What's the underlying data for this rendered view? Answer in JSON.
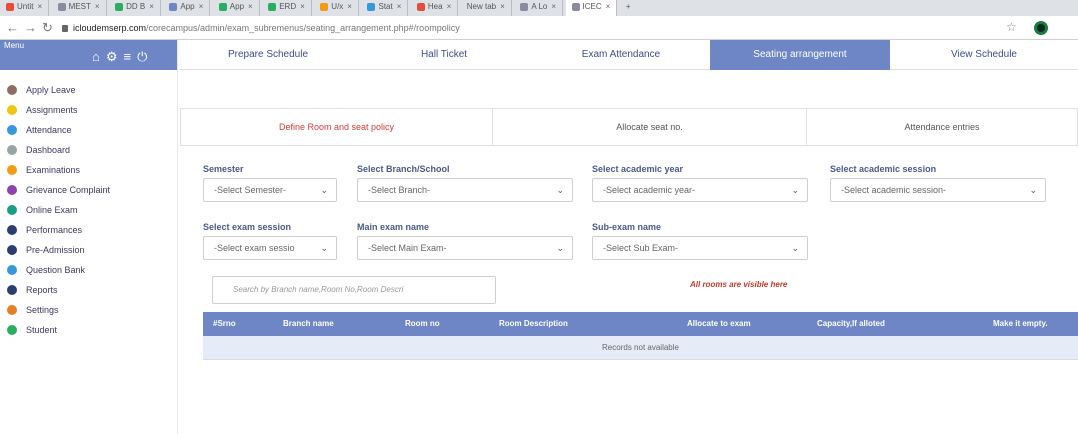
{
  "browser": {
    "tabs": [
      {
        "label": "Untit",
        "color": "#e74c3c"
      },
      {
        "label": "MEST",
        "color": "#8a8aa0"
      },
      {
        "label": "DD B",
        "color": "#27ae60"
      },
      {
        "label": "App",
        "color": "#6f86c6"
      },
      {
        "label": "App",
        "color": "#27ae60"
      },
      {
        "label": "ERD",
        "color": "#27ae60"
      },
      {
        "label": "U/x",
        "color": "#f39c12"
      },
      {
        "label": "Stat",
        "color": "#3498db"
      },
      {
        "label": "Hea",
        "color": "#e74c3c"
      },
      {
        "label": "New tab",
        "color": "#dee1e6"
      },
      {
        "label": "A Lo",
        "color": "#8a8aa0"
      },
      {
        "label": "ICEC",
        "color": "#8a8aa0"
      }
    ],
    "url_host": "icloudemserp.com",
    "url_path": "/corecampus/admin/exam_subremenus/seating_arrangement.php#/roompolicy"
  },
  "sidebar": {
    "menu_label": "Menu",
    "items": [
      {
        "label": "Apply Leave",
        "color": "#8d6e63"
      },
      {
        "label": "Assignments",
        "color": "#f1c40f"
      },
      {
        "label": "Attendance",
        "color": "#3498db"
      },
      {
        "label": "Dashboard",
        "color": "#95a5a6"
      },
      {
        "label": "Examinations",
        "color": "#f39c12"
      },
      {
        "label": "Grievance Complaint",
        "color": "#8e44ad"
      },
      {
        "label": "Online Exam",
        "color": "#16a085"
      },
      {
        "label": "Performances",
        "color": "#2c3e6e"
      },
      {
        "label": "Pre-Admission",
        "color": "#2c3e6e"
      },
      {
        "label": "Question Bank",
        "color": "#3498db"
      },
      {
        "label": "Reports",
        "color": "#2c3e6e"
      },
      {
        "label": "Settings",
        "color": "#e67e22"
      },
      {
        "label": "Student",
        "color": "#27ae60"
      }
    ]
  },
  "topnav": {
    "tabs": [
      "Prepare Schedule",
      "Hall Ticket",
      "Exam Attendance",
      "Seating arrangement",
      "View Schedule"
    ],
    "active": "Seating arrangement"
  },
  "subtabs": {
    "items": [
      "Define Room and seat policy",
      "Allocate seat no.",
      "Attendance entries"
    ],
    "active": "Define Room and seat policy"
  },
  "filters": {
    "semester": {
      "label": "Semester",
      "value": "-Select Semester-"
    },
    "branch": {
      "label": "Select Branch/School",
      "value": "-Select Branch-"
    },
    "academic_year": {
      "label": "Select academic year",
      "value": "-Select academic year-"
    },
    "academic_session": {
      "label": "Select academic session",
      "value": "-Select academic session-"
    },
    "exam_session": {
      "label": "Select exam session",
      "value": "-Select exam sessio"
    },
    "main_exam": {
      "label": "Main exam name",
      "value": "-Select Main Exam-"
    },
    "sub_exam": {
      "label": "Sub-exam name",
      "value": "-Select Sub Exam-"
    }
  },
  "search": {
    "placeholder": "Search by Branch name,Room No,Room Descri"
  },
  "note": "All rooms are visible here",
  "table": {
    "columns": [
      "#Srno",
      "Branch name",
      "Room no",
      "Room Description",
      "Allocate to exam",
      "Capacity,If alloted",
      "Make it empty."
    ],
    "empty_message": "Records not available"
  },
  "colors": {
    "accent": "#6f86c6",
    "active_subtab": "#d23a3a"
  }
}
